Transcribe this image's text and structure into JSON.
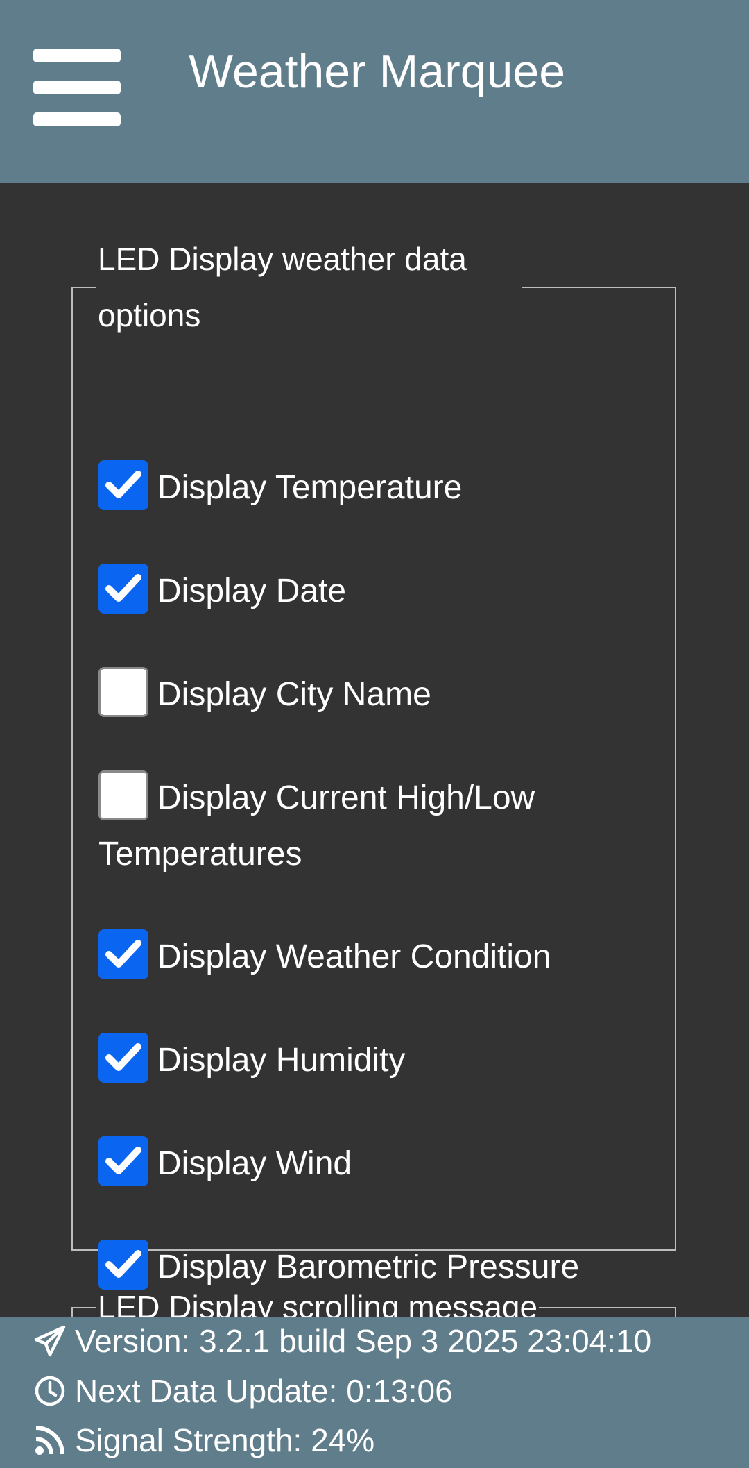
{
  "header": {
    "title": "Weather Marquee",
    "menu_icon": "hamburger-menu-icon"
  },
  "weather_options": {
    "legend": "LED Display weather data options",
    "items": [
      {
        "label": "Display Temperature",
        "checked": true
      },
      {
        "label": "Display Date",
        "checked": true
      },
      {
        "label": "Display City Name",
        "checked": false
      },
      {
        "label": "Display Current High/Low Temperatures",
        "checked": false
      },
      {
        "label": "Display Weather Condition",
        "checked": true
      },
      {
        "label": "Display Humidity",
        "checked": true
      },
      {
        "label": "Display Wind",
        "checked": true
      },
      {
        "label": "Display Barometric Pressure",
        "checked": true
      }
    ]
  },
  "scrolling_message": {
    "legend": "LED Display scrolling message"
  },
  "footer": {
    "version": "Version: 3.2.1 build Sep 3 2025 23:04:10",
    "next_update": "Next Data Update: 0:13:06",
    "signal": "Signal Strength: 24%"
  },
  "colors": {
    "header_bg": "#607d8b",
    "body_bg": "#333333",
    "checkbox_on": "#0a66f0"
  }
}
